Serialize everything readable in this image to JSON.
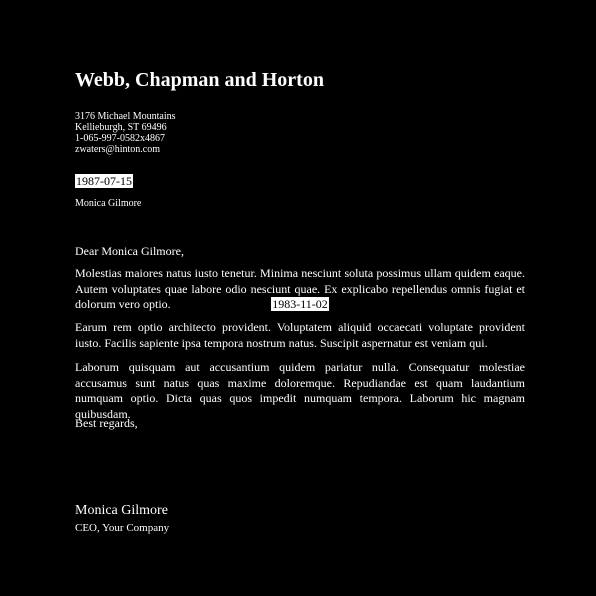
{
  "company": {
    "name": "Webb, Chapman and Horton",
    "address_line1": "3176 Michael Mountains",
    "address_line2": "Kellieburgh, ST 69496",
    "phone": "1-065-997-0582x4867",
    "email": "zwaters@hinton.com"
  },
  "letter": {
    "date": "1987-07-15",
    "recipient": "Monica Gilmore",
    "salutation": "Dear Monica Gilmore,",
    "paragraph1": "Molestias maiores natus iusto tenetur. Minima nesciunt soluta possimus ullam quidem eaque. Autem voluptates quae labore odio nesciunt quae. Ex explicabo repellendus omnis fugiat et dolorum vero optio.",
    "inline_date": "1983-11-02",
    "paragraph2": "Earum rem optio architecto provident. Voluptatem aliquid occaecati voluptate provident iusto. Facilis sapiente ipsa tempora nostrum natus. Suscipit aspernatur est veniam qui.",
    "paragraph3": "Laborum quisquam aut accusantium quidem pariatur nulla. Consequatur molestiae accusamus sunt natus quas maxime doloremque. Repudiandae est quam laudantium numquam optio. Dicta quas quos impedit numquam tempora. Laborum hic magnam quibusdam.",
    "closing": "Best regards,",
    "signature_name": "Monica Gilmore",
    "signature_title": "CEO, Your Company"
  },
  "colors": {
    "background": "#000000",
    "text": "#ffffff",
    "highlight_bg": "#ffffff",
    "highlight_text": "#000000"
  }
}
